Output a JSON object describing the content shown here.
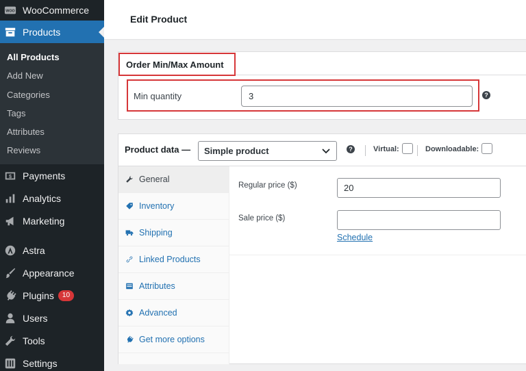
{
  "sidebar": {
    "top_items": [
      {
        "label": "WooCommerce",
        "icon": "woocommerce-icon"
      },
      {
        "label": "Products",
        "icon": "products-archive-icon"
      }
    ],
    "submenu": [
      "All Products",
      "Add New",
      "Categories",
      "Tags",
      "Attributes",
      "Reviews"
    ],
    "items": [
      {
        "label": "Payments",
        "icon": "payments-icon"
      },
      {
        "label": "Analytics",
        "icon": "analytics-icon"
      },
      {
        "label": "Marketing",
        "icon": "megaphone-icon"
      },
      {
        "label": "Astra",
        "icon": "astra-icon"
      },
      {
        "label": "Appearance",
        "icon": "paintbrush-icon"
      },
      {
        "label": "Plugins",
        "icon": "plugin-icon",
        "badge": "10"
      },
      {
        "label": "Users",
        "icon": "users-icon"
      },
      {
        "label": "Tools",
        "icon": "wrench-icon"
      },
      {
        "label": "Settings",
        "icon": "settings-icon"
      }
    ],
    "colors": {
      "bg": "#1d2327",
      "active": "#2271b1",
      "submenu_bg": "#2c3338"
    }
  },
  "header": {
    "title": "Edit Product"
  },
  "order_minmax": {
    "title": "Order Min/Max Amount",
    "min_label": "Min quantity",
    "min_value": "3",
    "highlight_color": "#d63638"
  },
  "product_data": {
    "label": "Product data —",
    "type_selected": "Simple product",
    "virtual_label": "Virtual:",
    "downloadable_label": "Downloadable:",
    "tabs": [
      {
        "label": "General",
        "icon": "wrench-icon"
      },
      {
        "label": "Inventory",
        "icon": "tag-icon"
      },
      {
        "label": "Shipping",
        "icon": "truck-icon"
      },
      {
        "label": "Linked Products",
        "icon": "link-icon"
      },
      {
        "label": "Attributes",
        "icon": "list-icon"
      },
      {
        "label": "Advanced",
        "icon": "gear-icon"
      },
      {
        "label": "Get more options",
        "icon": "plugin-icon"
      }
    ],
    "regular_price_label": "Regular price ($)",
    "regular_price_value": "20",
    "sale_price_label": "Sale price ($)",
    "sale_price_value": "",
    "schedule_label": "Schedule"
  }
}
